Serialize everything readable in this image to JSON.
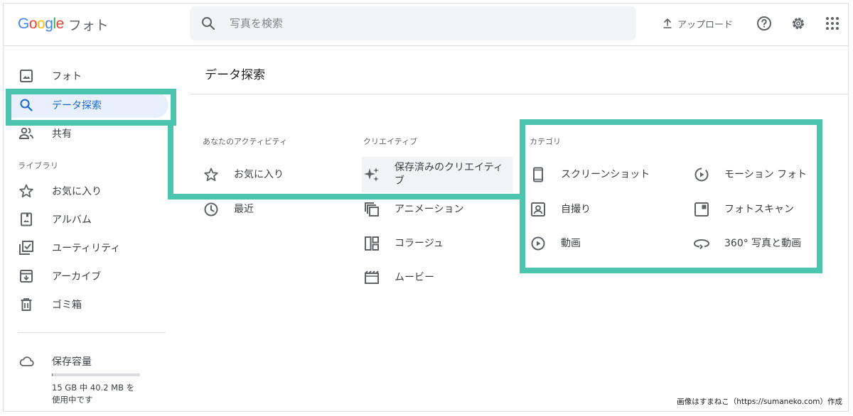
{
  "header": {
    "logo_google": "Google",
    "logo_product": "フォト",
    "search_placeholder": "写真を検索",
    "upload_label": "アップロード"
  },
  "sidebar": {
    "items": [
      {
        "label": "フォト",
        "icon": "photo-icon"
      },
      {
        "label": "データ探索",
        "icon": "search-icon",
        "active": true
      },
      {
        "label": "共有",
        "icon": "people-icon"
      }
    ],
    "library_label": "ライブラリ",
    "library_items": [
      {
        "label": "お気に入り",
        "icon": "star-icon"
      },
      {
        "label": "アルバム",
        "icon": "album-icon"
      },
      {
        "label": "ユーティリティ",
        "icon": "utility-icon"
      },
      {
        "label": "アーカイブ",
        "icon": "archive-icon"
      },
      {
        "label": "ゴミ箱",
        "icon": "trash-icon"
      }
    ],
    "storage": {
      "label": "保存容量",
      "detail_line1": "15 GB 中 40.2 MB を",
      "detail_line2": "使用中です",
      "fraction_used": 0.0027
    }
  },
  "main": {
    "title": "データ探索",
    "activity": {
      "label": "あなたのアクティビティ",
      "items": [
        {
          "label": "お気に入り",
          "icon": "star-icon"
        },
        {
          "label": "最近",
          "icon": "clock-icon"
        }
      ]
    },
    "creative": {
      "label": "クリエイティブ",
      "items": [
        {
          "label_line1": "保存済みのクリエイティ",
          "label_line2": "ブ",
          "icon": "sparkle-icon"
        },
        {
          "label": "アニメーション",
          "icon": "animation-icon"
        },
        {
          "label": "コラージュ",
          "icon": "collage-icon"
        },
        {
          "label": "ムービー",
          "icon": "movie-icon"
        }
      ]
    },
    "category": {
      "label": "カテゴリ",
      "items": [
        {
          "label": "スクリーンショット",
          "icon": "phone-icon"
        },
        {
          "label": "モーション フォト",
          "icon": "motion-photo-icon"
        },
        {
          "label": "自撮り",
          "icon": "selfie-icon"
        },
        {
          "label": "フォトスキャン",
          "icon": "photoscan-icon"
        },
        {
          "label": "動画",
          "icon": "play-icon"
        },
        {
          "label": "360° 写真と動画",
          "icon": "panorama-360-icon"
        }
      ]
    }
  },
  "watermark": "画像はすまねこ（https://sumaneko.com）作成",
  "colors": {
    "annotation": "#4dc4ae",
    "active_bg": "#e8f0fe",
    "active_text": "#1967d2",
    "search_bg": "#f1f3f4",
    "google_blue": "#4285f4",
    "google_red": "#ea4335",
    "google_yellow": "#fbbc05",
    "google_green": "#34a853"
  }
}
